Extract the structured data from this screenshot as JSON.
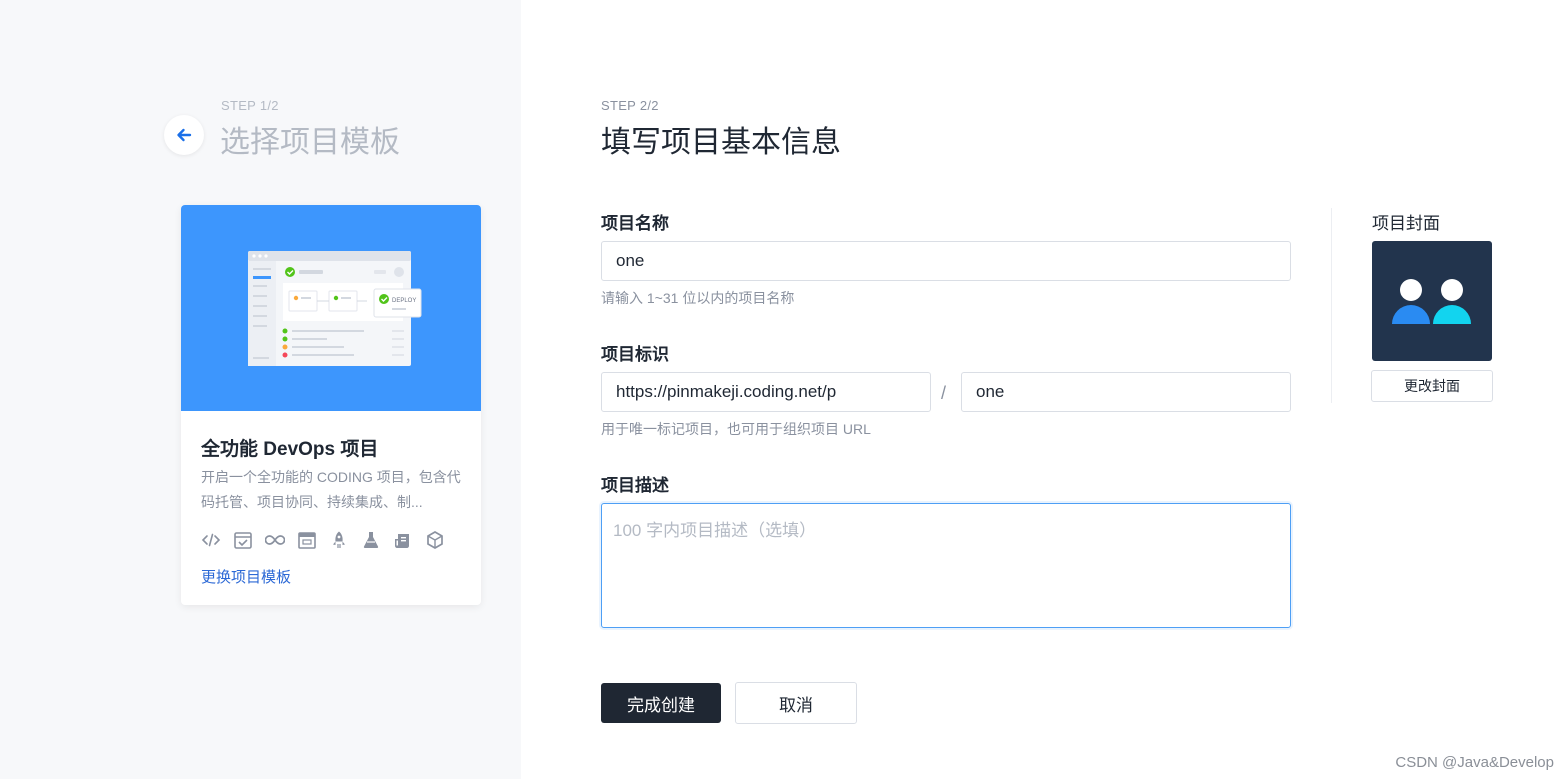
{
  "step1": {
    "label": "STEP 1/2",
    "title": "选择项目模板"
  },
  "template_card": {
    "title": "全功能 DevOps 项目",
    "description": "开启一个全功能的 CODING 项目，包含代码托管、项目协同、持续集成、制...",
    "banner_badge": "DEPLOY",
    "icons": [
      "code-icon",
      "task-check-icon",
      "infinity-icon",
      "window-icon",
      "rocket-icon",
      "flask-icon",
      "artifact-icon",
      "package-icon"
    ],
    "change_link": "更换项目模板",
    "banner_color": "#3d96fd"
  },
  "step2": {
    "label": "STEP 2/2",
    "title": "填写项目基本信息"
  },
  "form": {
    "name": {
      "label": "项目名称",
      "value": "one",
      "hint": "请输入 1~31 位以内的项目名称"
    },
    "identifier": {
      "label": "项目标识",
      "prefix_value": "https://pinmakeji.coding.net/p",
      "separator": "/",
      "value": "one",
      "hint": "用于唯一标记项目，也可用于组织项目 URL"
    },
    "description": {
      "label": "项目描述",
      "value": "",
      "placeholder": "100 字内项目描述（选填）"
    }
  },
  "cover": {
    "label": "项目封面",
    "change_button": "更改封面",
    "bg_color": "#22344d",
    "person_left_color": "#2a8bf2",
    "person_right_color": "#12d4ef"
  },
  "actions": {
    "submit": "完成创建",
    "cancel": "取消"
  },
  "watermark": "CSDN @Java&Develop",
  "colors": {
    "primary_dark": "#1f2733",
    "link_blue": "#2c69d6",
    "focus_blue": "#4e9ff5"
  }
}
